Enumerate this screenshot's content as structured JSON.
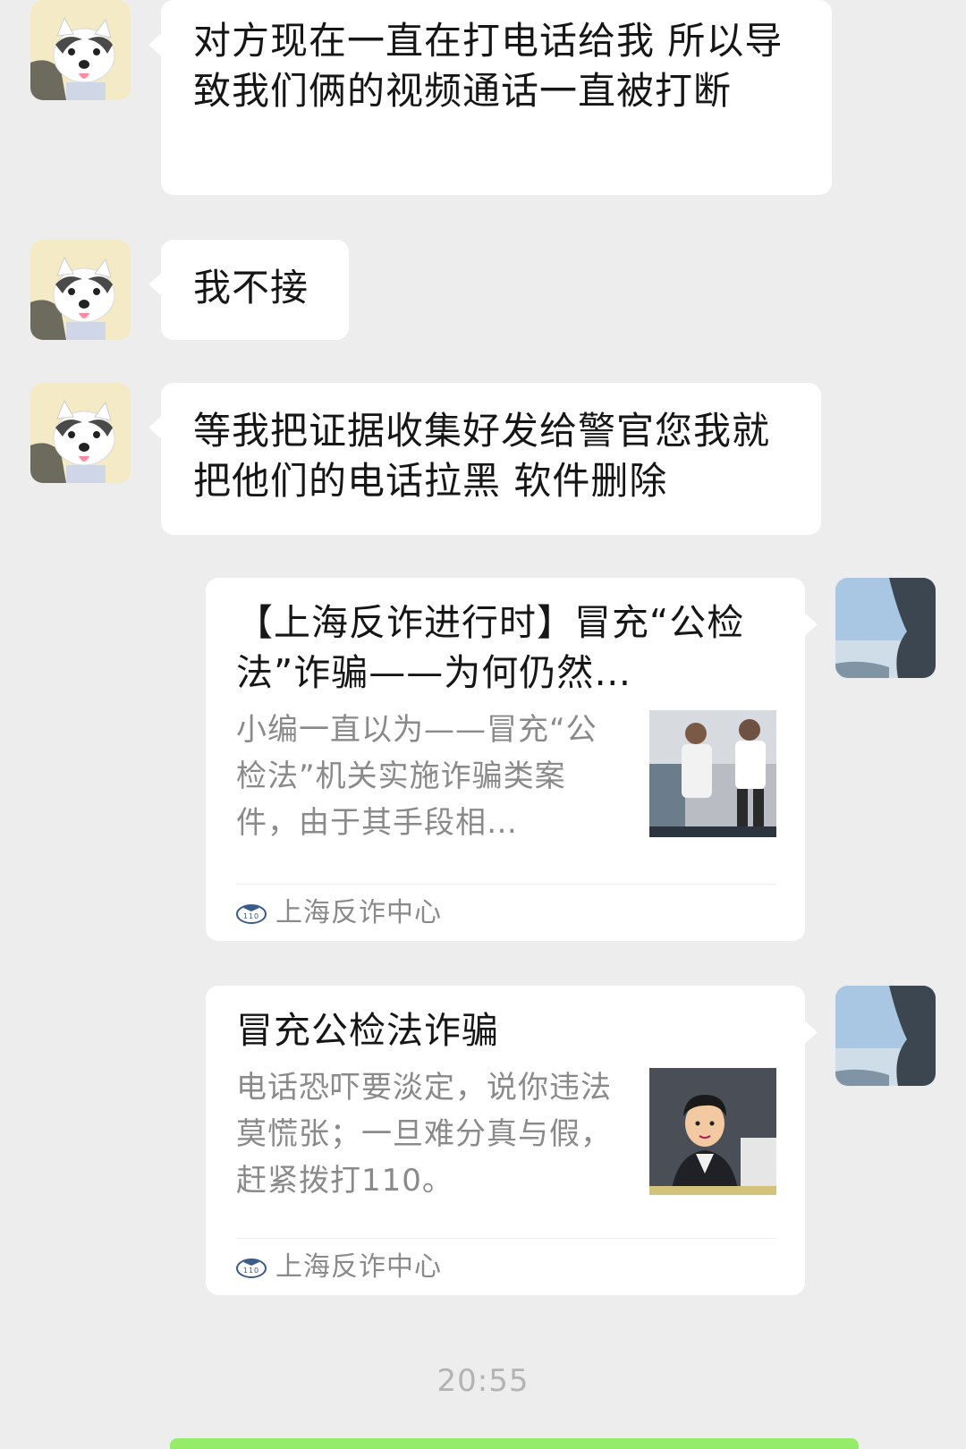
{
  "messages": [
    {
      "side": "left",
      "avatar": "cat-avatar",
      "text": "对方现在一直在打电话给我 所以导致我们俩的视频通话一直被打断"
    },
    {
      "side": "left",
      "avatar": "cat-avatar",
      "text": "我不接"
    },
    {
      "side": "left",
      "avatar": "cat-avatar",
      "text": "等我把证据收集好发给警官您我就把他们的电话拉黑 软件删除"
    }
  ],
  "cards": [
    {
      "title": "【上海反诈进行时】冒充“公检法”诈骗——为何仍然…",
      "description": "小编一直以为——冒充“公检法”机关实施诈骗类案件，由于其手段相…",
      "source": "上海反诈中心",
      "thumbnail_icon": "people-photo-thumbnail"
    },
    {
      "title": "冒充公检法诈骗",
      "description": "电话恐吓要淡定，说你违法莫慌张；一旦难分真与假，赶紧拨打110。",
      "source": "上海反诈中心",
      "thumbnail_icon": "cartoon-man-thumbnail"
    }
  ],
  "timestamp": "20:55",
  "colors": {
    "background": "#ededed",
    "bubble": "#ffffff",
    "sent_bubble": "#95ec69",
    "muted_text": "#8a8a8a"
  }
}
